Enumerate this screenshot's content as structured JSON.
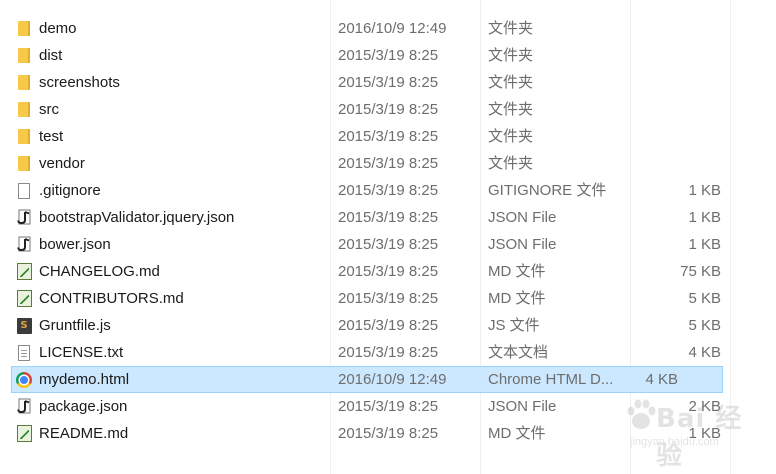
{
  "files": [
    {
      "icon": "folder-icon",
      "name": "demo",
      "date": "2016/10/9 12:49",
      "type": "文件夹",
      "size": ""
    },
    {
      "icon": "folder-icon",
      "name": "dist",
      "date": "2015/3/19 8:25",
      "type": "文件夹",
      "size": ""
    },
    {
      "icon": "folder-icon",
      "name": "screenshots",
      "date": "2015/3/19 8:25",
      "type": "文件夹",
      "size": ""
    },
    {
      "icon": "folder-icon",
      "name": "src",
      "date": "2015/3/19 8:25",
      "type": "文件夹",
      "size": ""
    },
    {
      "icon": "folder-icon",
      "name": "test",
      "date": "2015/3/19 8:25",
      "type": "文件夹",
      "size": ""
    },
    {
      "icon": "folder-icon",
      "name": "vendor",
      "date": "2015/3/19 8:25",
      "type": "文件夹",
      "size": ""
    },
    {
      "icon": "blank-file-icon",
      "name": ".gitignore",
      "date": "2015/3/19 8:25",
      "type": "GITIGNORE 文件",
      "size": "1 KB"
    },
    {
      "icon": "json-file-icon",
      "name": "bootstrapValidator.jquery.json",
      "date": "2015/3/19 8:25",
      "type": "JSON File",
      "size": "1 KB"
    },
    {
      "icon": "json-file-icon",
      "name": "bower.json",
      "date": "2015/3/19 8:25",
      "type": "JSON File",
      "size": "1 KB"
    },
    {
      "icon": "markdown-file-icon",
      "name": "CHANGELOG.md",
      "date": "2015/3/19 8:25",
      "type": "MD 文件",
      "size": "75 KB"
    },
    {
      "icon": "markdown-file-icon",
      "name": "CONTRIBUTORS.md",
      "date": "2015/3/19 8:25",
      "type": "MD 文件",
      "size": "5 KB"
    },
    {
      "icon": "js-file-icon",
      "name": "Gruntfile.js",
      "date": "2015/3/19 8:25",
      "type": "JS 文件",
      "size": "5 KB"
    },
    {
      "icon": "text-file-icon",
      "name": "LICENSE.txt",
      "date": "2015/3/19 8:25",
      "type": "文本文档",
      "size": "4 KB"
    },
    {
      "icon": "chrome-html-icon",
      "name": "mydemo.html",
      "date": "2016/10/9 12:49",
      "type": "Chrome HTML D...",
      "size": "4 KB",
      "selected": true
    },
    {
      "icon": "json-file-icon",
      "name": "package.json",
      "date": "2015/3/19 8:25",
      "type": "JSON File",
      "size": "2 KB"
    },
    {
      "icon": "markdown-file-icon",
      "name": "README.md",
      "date": "2015/3/19 8:25",
      "type": "MD 文件",
      "size": "1 KB"
    }
  ],
  "colors": {
    "selection_bg": "#cce8ff",
    "selection_border": "#99d1ff",
    "folder": "#f6c94a"
  },
  "watermark": {
    "brand": "Bai 经验",
    "url": "jingyan.baidu.com"
  }
}
